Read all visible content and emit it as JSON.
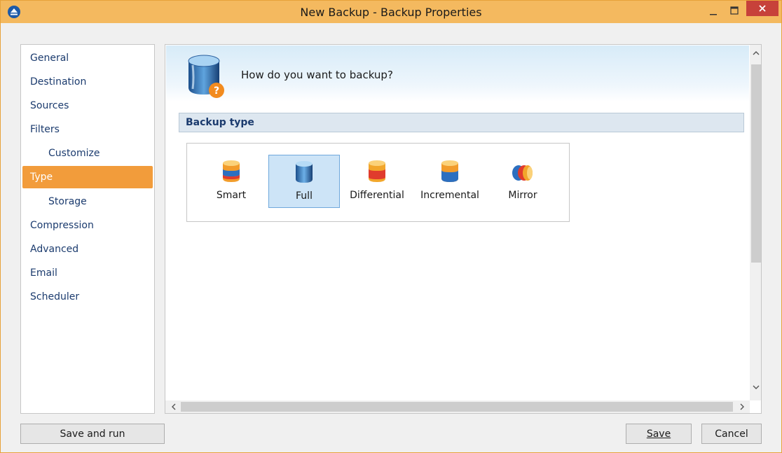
{
  "window": {
    "title": "New Backup - Backup Properties"
  },
  "nav": {
    "items": [
      {
        "label": "General"
      },
      {
        "label": "Destination"
      },
      {
        "label": "Sources"
      },
      {
        "label": "Filters"
      },
      {
        "label": "Customize"
      },
      {
        "label": "Type",
        "active": true
      },
      {
        "label": "Storage"
      },
      {
        "label": "Compression"
      },
      {
        "label": "Advanced"
      },
      {
        "label": "Email"
      },
      {
        "label": "Scheduler"
      }
    ]
  },
  "main": {
    "question": "How do you want to backup?",
    "section_title": "Backup type",
    "options": [
      {
        "label": "Smart",
        "icon": "smart-db-icon"
      },
      {
        "label": "Full",
        "icon": "full-db-icon",
        "selected": true
      },
      {
        "label": "Differential",
        "icon": "differential-db-icon"
      },
      {
        "label": "Incremental",
        "icon": "incremental-db-icon"
      },
      {
        "label": "Mirror",
        "icon": "mirror-db-icon"
      }
    ]
  },
  "buttons": {
    "save_and_run": "Save and run",
    "save": "Save",
    "cancel": "Cancel"
  },
  "colors": {
    "titlebar": "#f4b95f",
    "nav_active": "#f29c3b",
    "close_button": "#c7413a",
    "selected_option": "#cde4f7"
  }
}
